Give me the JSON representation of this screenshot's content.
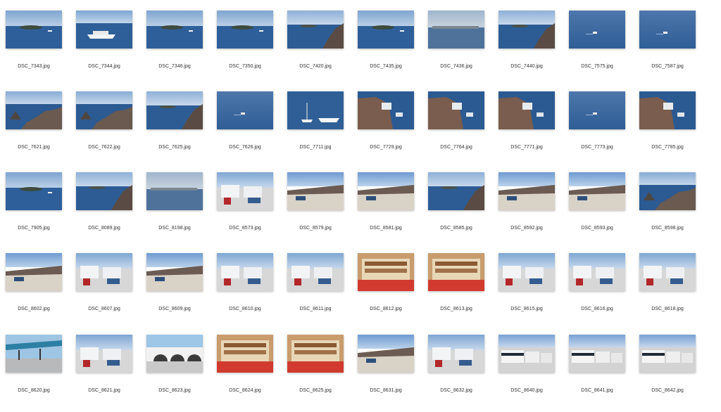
{
  "files": [
    {
      "name": "DSC_7343.jpg",
      "scene": "sea-island"
    },
    {
      "name": "DSC_7344.jpg",
      "scene": "ship"
    },
    {
      "name": "DSC_7346.jpg",
      "scene": "sea-island"
    },
    {
      "name": "DSC_7350.jpg",
      "scene": "sea-island"
    },
    {
      "name": "DSC_7420.jpg",
      "scene": "sea-cliff"
    },
    {
      "name": "DSC_7435.jpg",
      "scene": "sea-island"
    },
    {
      "name": "DSC_7436.jpg",
      "scene": "sea-haze"
    },
    {
      "name": "DSC_7440.jpg",
      "scene": "sea-cliff"
    },
    {
      "name": "DSC_7575.jpg",
      "scene": "open-sea"
    },
    {
      "name": "DSC_7587.jpg",
      "scene": "open-sea"
    },
    {
      "name": "DSC_7621.jpg",
      "scene": "rocky-coast"
    },
    {
      "name": "DSC_7622.jpg",
      "scene": "rocky-coast"
    },
    {
      "name": "DSC_7625.jpg",
      "scene": "sea-cliff"
    },
    {
      "name": "DSC_7626.jpg",
      "scene": "open-sea"
    },
    {
      "name": "DSC_7711.jpg",
      "scene": "harbor"
    },
    {
      "name": "DSC_7729.jpg",
      "scene": "town-cliff"
    },
    {
      "name": "DSC_7764.jpg",
      "scene": "town-cliff"
    },
    {
      "name": "DSC_7771.jpg",
      "scene": "town-cliff"
    },
    {
      "name": "DSC_7773.jpg",
      "scene": "open-sea"
    },
    {
      "name": "DSC_7785.jpg",
      "scene": "town-cliff"
    },
    {
      "name": "DSC_7905.jpg",
      "scene": "sea-island"
    },
    {
      "name": "DSC_8089.jpg",
      "scene": "sea-cliff"
    },
    {
      "name": "DSC_8198.jpg",
      "scene": "sea-haze"
    },
    {
      "name": "DSC_8573.jpg",
      "scene": "port-buildings"
    },
    {
      "name": "DSC_8579.jpg",
      "scene": "port-road"
    },
    {
      "name": "DSC_8581.jpg",
      "scene": "port-road"
    },
    {
      "name": "DSC_8585.jpg",
      "scene": "sea-cliff"
    },
    {
      "name": "DSC_8592.jpg",
      "scene": "port-road"
    },
    {
      "name": "DSC_8593.jpg",
      "scene": "port-road"
    },
    {
      "name": "DSC_8598.jpg",
      "scene": "rocky-coast"
    },
    {
      "name": "DSC_8602.jpg",
      "scene": "port-road"
    },
    {
      "name": "DSC_8607.jpg",
      "scene": "port-buildings"
    },
    {
      "name": "DSC_8609.jpg",
      "scene": "port-road"
    },
    {
      "name": "DSC_8610.jpg",
      "scene": "port-buildings"
    },
    {
      "name": "DSC_8611.jpg",
      "scene": "port-buildings"
    },
    {
      "name": "DSC_8612.jpg",
      "scene": "shop"
    },
    {
      "name": "DSC_8613.jpg",
      "scene": "shop"
    },
    {
      "name": "DSC_8615.jpg",
      "scene": "port-buildings"
    },
    {
      "name": "DSC_8616.jpg",
      "scene": "port-buildings"
    },
    {
      "name": "DSC_8618.jpg",
      "scene": "port-buildings"
    },
    {
      "name": "DSC_8620.jpg",
      "scene": "canopy"
    },
    {
      "name": "DSC_8621.jpg",
      "scene": "port-buildings"
    },
    {
      "name": "DSC_8623.jpg",
      "scene": "arches"
    },
    {
      "name": "DSC_8624.jpg",
      "scene": "shop"
    },
    {
      "name": "DSC_8625.jpg",
      "scene": "shop"
    },
    {
      "name": "DSC_8631.jpg",
      "scene": "port-road"
    },
    {
      "name": "DSC_8632.jpg",
      "scene": "port-buildings"
    },
    {
      "name": "DSC_8640.jpg",
      "scene": "buses"
    },
    {
      "name": "DSC_8641.jpg",
      "scene": "buses"
    },
    {
      "name": "DSC_8642.jpg",
      "scene": "buses"
    }
  ]
}
